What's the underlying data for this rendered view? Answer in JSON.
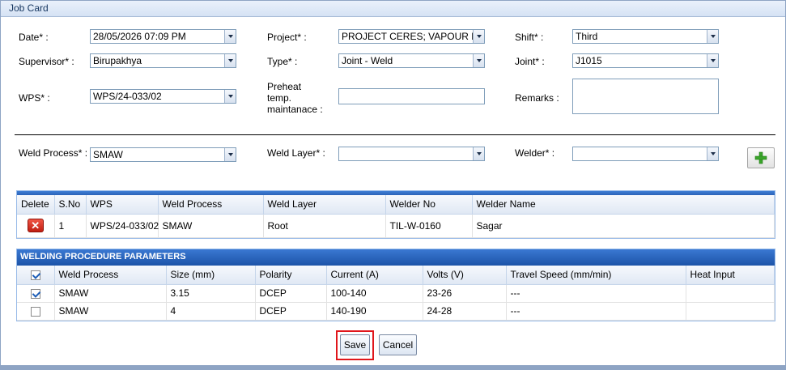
{
  "window": {
    "title": "Job Card"
  },
  "form": {
    "date": {
      "label": "Date* :",
      "value": "28/05/2026 07:09 PM"
    },
    "project": {
      "label": "Project* :",
      "value": "PROJECT CERES; VAPOUR DISEN("
    },
    "shift": {
      "label": "Shift* :",
      "value": "Third"
    },
    "supervisor": {
      "label": "Supervisor* :",
      "value": "Birupakhya"
    },
    "type": {
      "label": "Type* :",
      "value": "Joint - Weld"
    },
    "joint": {
      "label": "Joint* :",
      "value": "J1015"
    },
    "wps": {
      "label": "WPS* :",
      "value": "WPS/24-033/02"
    },
    "preheat": {
      "label_line1": "Preheat",
      "label_line2": "temp.",
      "label_line3": "maintanace :",
      "value": ""
    },
    "remarks": {
      "label": "Remarks :",
      "value": ""
    },
    "weld_process": {
      "label": "Weld Process* :",
      "value": "SMAW"
    },
    "weld_layer": {
      "label": "Weld Layer* :",
      "value": ""
    },
    "welder": {
      "label": "Welder* :",
      "value": ""
    }
  },
  "icons": {
    "add": "plus-icon",
    "delete": "delete-x-icon",
    "dropdown": "chevron-down-icon"
  },
  "colors": {
    "header_blue": "#2b63b8",
    "delete_red": "#d42a1c",
    "add_green": "#3aa52a",
    "save_highlight": "#e0161b"
  },
  "entries_grid": {
    "headers": [
      "Delete",
      "S.No",
      "WPS",
      "Weld Process",
      "Weld Layer",
      "Welder No",
      "Welder Name"
    ],
    "rows": [
      {
        "sno": "1",
        "wps": "WPS/24-033/02",
        "weld_process": "SMAW",
        "weld_layer": "Root",
        "welder_no": "TIL-W-0160",
        "welder_name": "Sagar"
      }
    ]
  },
  "params_grid": {
    "caption": "WELDING PROCEDURE PARAMETERS",
    "headers": [
      "Weld Process",
      "Size (mm)",
      "Polarity",
      "Current (A)",
      "Volts (V)",
      "Travel Speed (mm/min)",
      "Heat Input"
    ],
    "rows": [
      {
        "checked": true,
        "weld_process": "SMAW",
        "size": "3.15",
        "polarity": "DCEP",
        "current": "100-140",
        "volts": "23-26",
        "travel_speed": "---",
        "heat_input": ""
      },
      {
        "checked": false,
        "weld_process": "SMAW",
        "size": "4",
        "polarity": "DCEP",
        "current": "140-190",
        "volts": "24-28",
        "travel_speed": "---",
        "heat_input": ""
      }
    ]
  },
  "buttons": {
    "save": "Save",
    "cancel": "Cancel"
  }
}
